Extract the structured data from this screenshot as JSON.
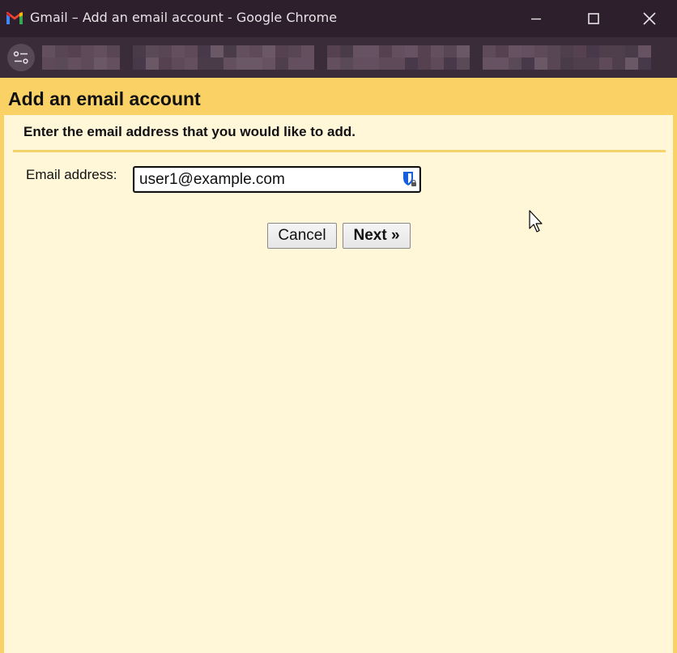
{
  "window": {
    "title": "Gmail – Add an email account - Google Chrome",
    "controls": [
      "minimize",
      "maximize",
      "close"
    ]
  },
  "toolbar": {
    "site_settings_icon": "tune-icon",
    "url_redacted": true
  },
  "page": {
    "heading": "Add an email account",
    "instruction": "Enter the email address that you would like to add.",
    "email_label": "Email address:",
    "email_value": "user1@example.com",
    "password_manager_icon": "bitwarden-shield-icon",
    "cancel_label": "Cancel",
    "next_label": "Next »"
  },
  "colors": {
    "titlebar": "#2d1f2b",
    "header_bg": "#fad165",
    "panel_bg": "#fff7d8"
  }
}
